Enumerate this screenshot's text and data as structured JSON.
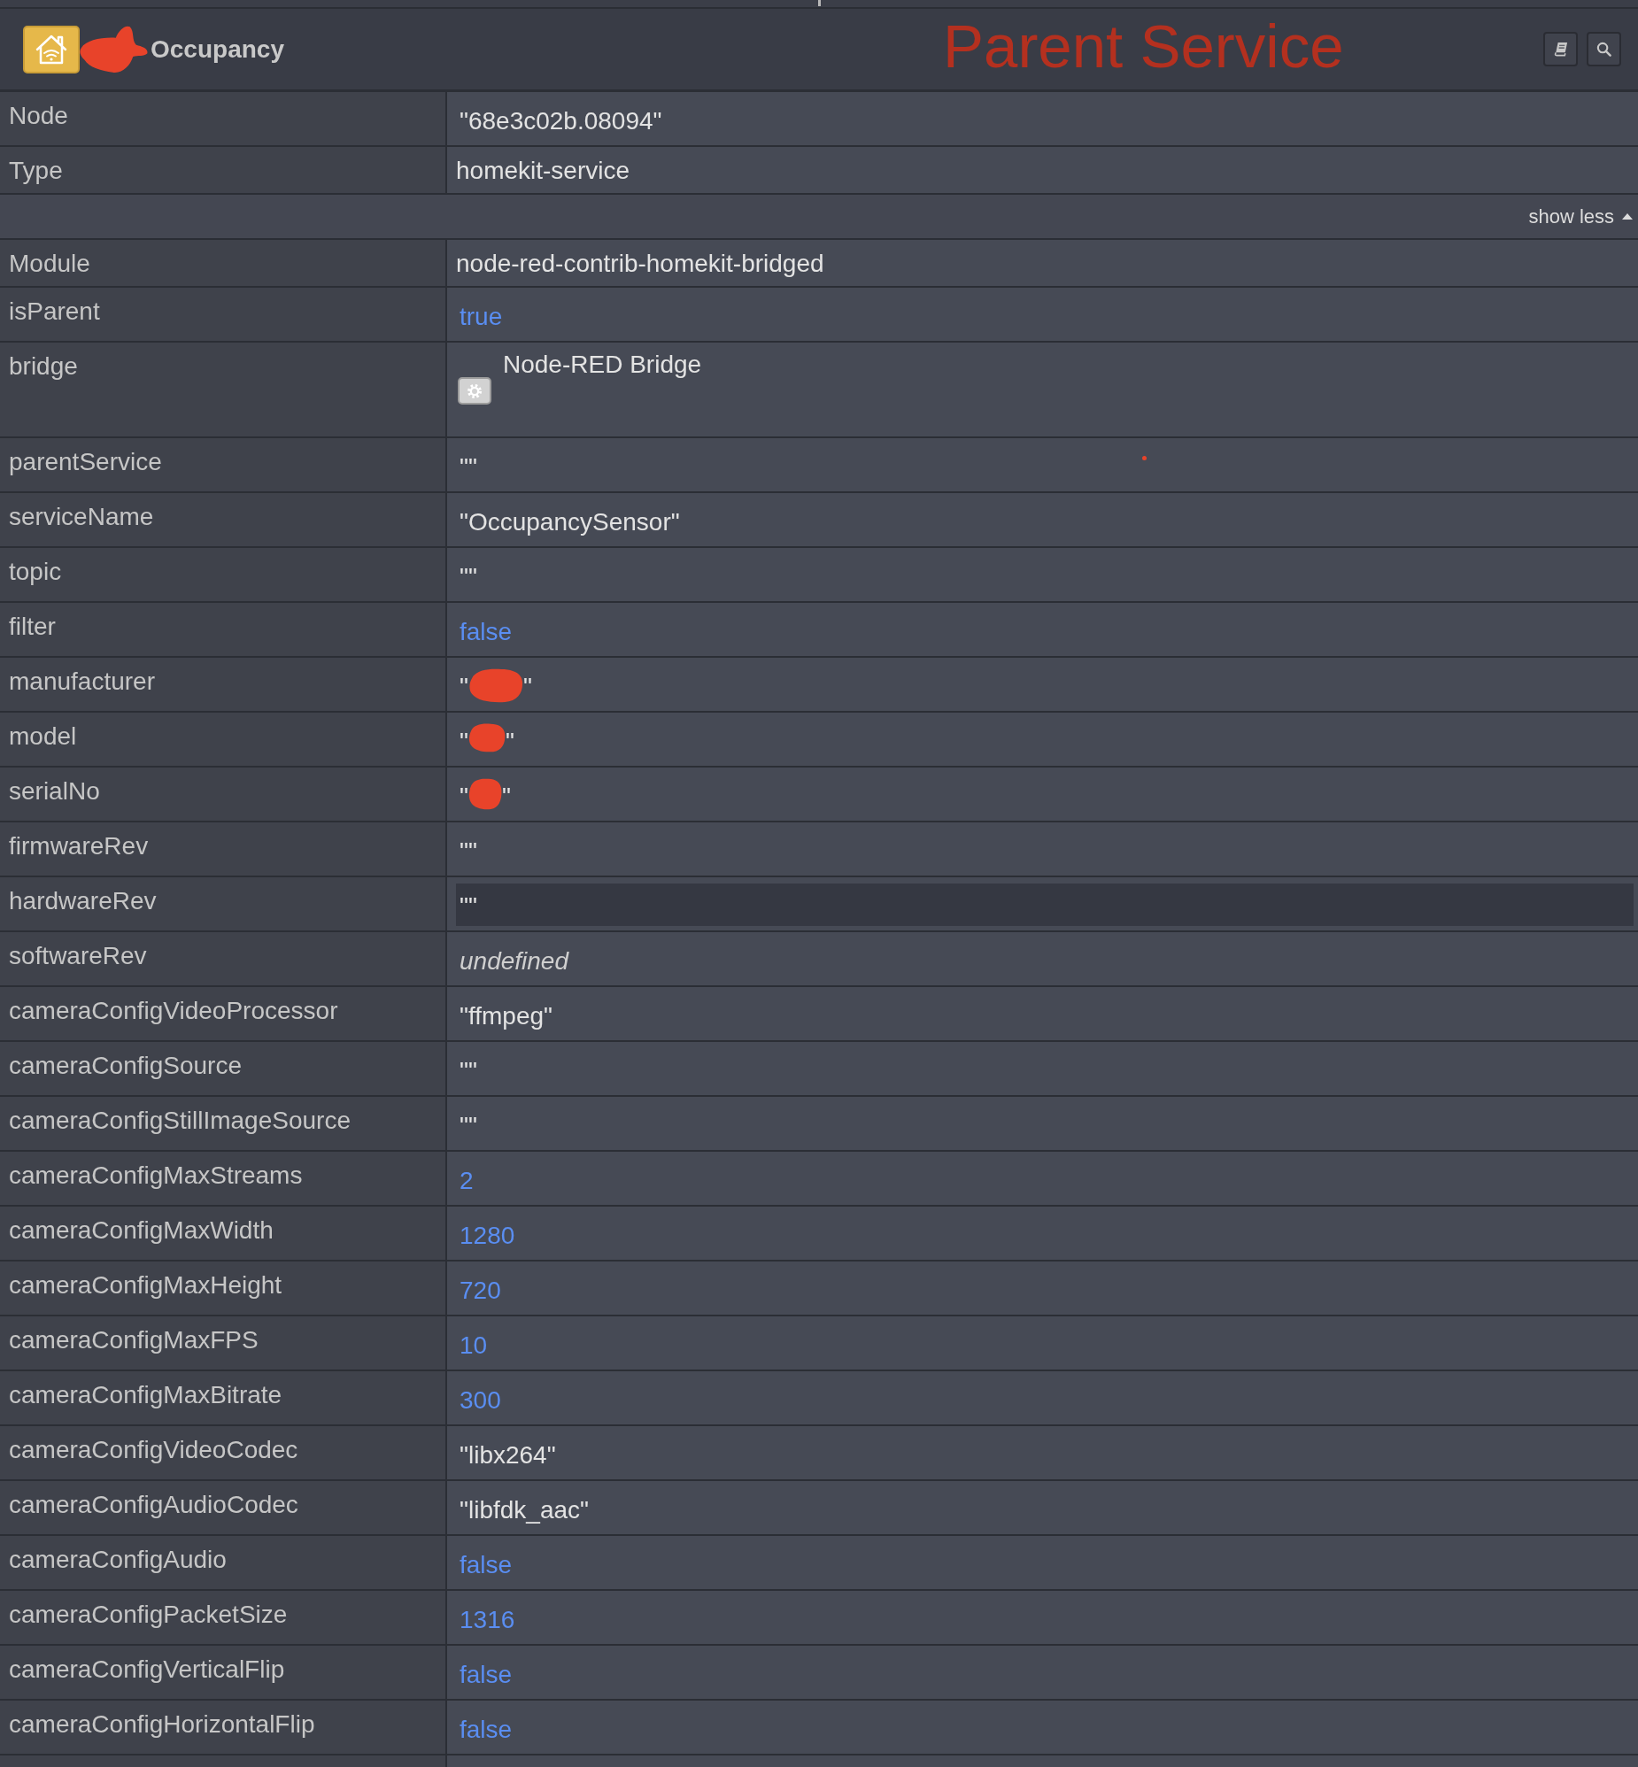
{
  "header": {
    "title": "Occupancy",
    "annotation": "Parent Service"
  },
  "summary": [
    {
      "label": "Node",
      "kind": "string",
      "value": "\"68e3c02b.08094\"",
      "highlighted": false
    },
    {
      "label": "Type",
      "kind": "plain",
      "value": "homekit-service",
      "highlighted": false
    }
  ],
  "toggle": {
    "label": "show less",
    "expanded": true
  },
  "properties": [
    {
      "label": "Module",
      "kind": "plain",
      "value": "node-red-contrib-homekit-bridged",
      "highlighted": false
    },
    {
      "label": "isParent",
      "kind": "boolean",
      "value": "true",
      "highlighted": false
    },
    {
      "label": "bridge",
      "kind": "config",
      "value": "Node-RED Bridge",
      "highlighted": false
    },
    {
      "label": "parentService",
      "kind": "string",
      "value": "\"\"",
      "highlighted": false
    },
    {
      "label": "serviceName",
      "kind": "string",
      "value": "\"OccupancySensor\"",
      "highlighted": false
    },
    {
      "label": "topic",
      "kind": "string",
      "value": "\"\"",
      "highlighted": false
    },
    {
      "label": "filter",
      "kind": "boolean",
      "value": "false",
      "highlighted": false
    },
    {
      "label": "manufacturer",
      "kind": "redacted",
      "value_parts": [
        "\"",
        "\""
      ],
      "highlighted": false
    },
    {
      "label": "model",
      "kind": "redacted",
      "value_parts": [
        "\"",
        "\""
      ],
      "highlighted": false
    },
    {
      "label": "serialNo",
      "kind": "redacted",
      "value_parts": [
        "\"",
        "\""
      ],
      "highlighted": false
    },
    {
      "label": "firmwareRev",
      "kind": "string",
      "value": "\"\"",
      "highlighted": false
    },
    {
      "label": "hardwareRev",
      "kind": "string",
      "value": "\"\"",
      "highlighted": true
    },
    {
      "label": "softwareRev",
      "kind": "undefined",
      "value": "undefined",
      "highlighted": false
    },
    {
      "label": "cameraConfigVideoProcessor",
      "kind": "string",
      "value": "\"ffmpeg\"",
      "highlighted": false
    },
    {
      "label": "cameraConfigSource",
      "kind": "string",
      "value": "\"\"",
      "highlighted": false
    },
    {
      "label": "cameraConfigStillImageSource",
      "kind": "string",
      "value": "\"\"",
      "highlighted": false
    },
    {
      "label": "cameraConfigMaxStreams",
      "kind": "number",
      "value": "2",
      "highlighted": false
    },
    {
      "label": "cameraConfigMaxWidth",
      "kind": "number",
      "value": "1280",
      "highlighted": false
    },
    {
      "label": "cameraConfigMaxHeight",
      "kind": "number",
      "value": "720",
      "highlighted": false
    },
    {
      "label": "cameraConfigMaxFPS",
      "kind": "number",
      "value": "10",
      "highlighted": false
    },
    {
      "label": "cameraConfigMaxBitrate",
      "kind": "number",
      "value": "300",
      "highlighted": false
    },
    {
      "label": "cameraConfigVideoCodec",
      "kind": "string",
      "value": "\"libx264\"",
      "highlighted": false
    },
    {
      "label": "cameraConfigAudioCodec",
      "kind": "string",
      "value": "\"libfdk_aac\"",
      "highlighted": false
    },
    {
      "label": "cameraConfigAudio",
      "kind": "boolean",
      "value": "false",
      "highlighted": false
    },
    {
      "label": "cameraConfigPacketSize",
      "kind": "number",
      "value": "1316",
      "highlighted": false
    },
    {
      "label": "cameraConfigVerticalFlip",
      "kind": "boolean",
      "value": "false",
      "highlighted": false
    },
    {
      "label": "cameraConfigHorizontalFlip",
      "kind": "boolean",
      "value": "false",
      "highlighted": false
    }
  ]
}
